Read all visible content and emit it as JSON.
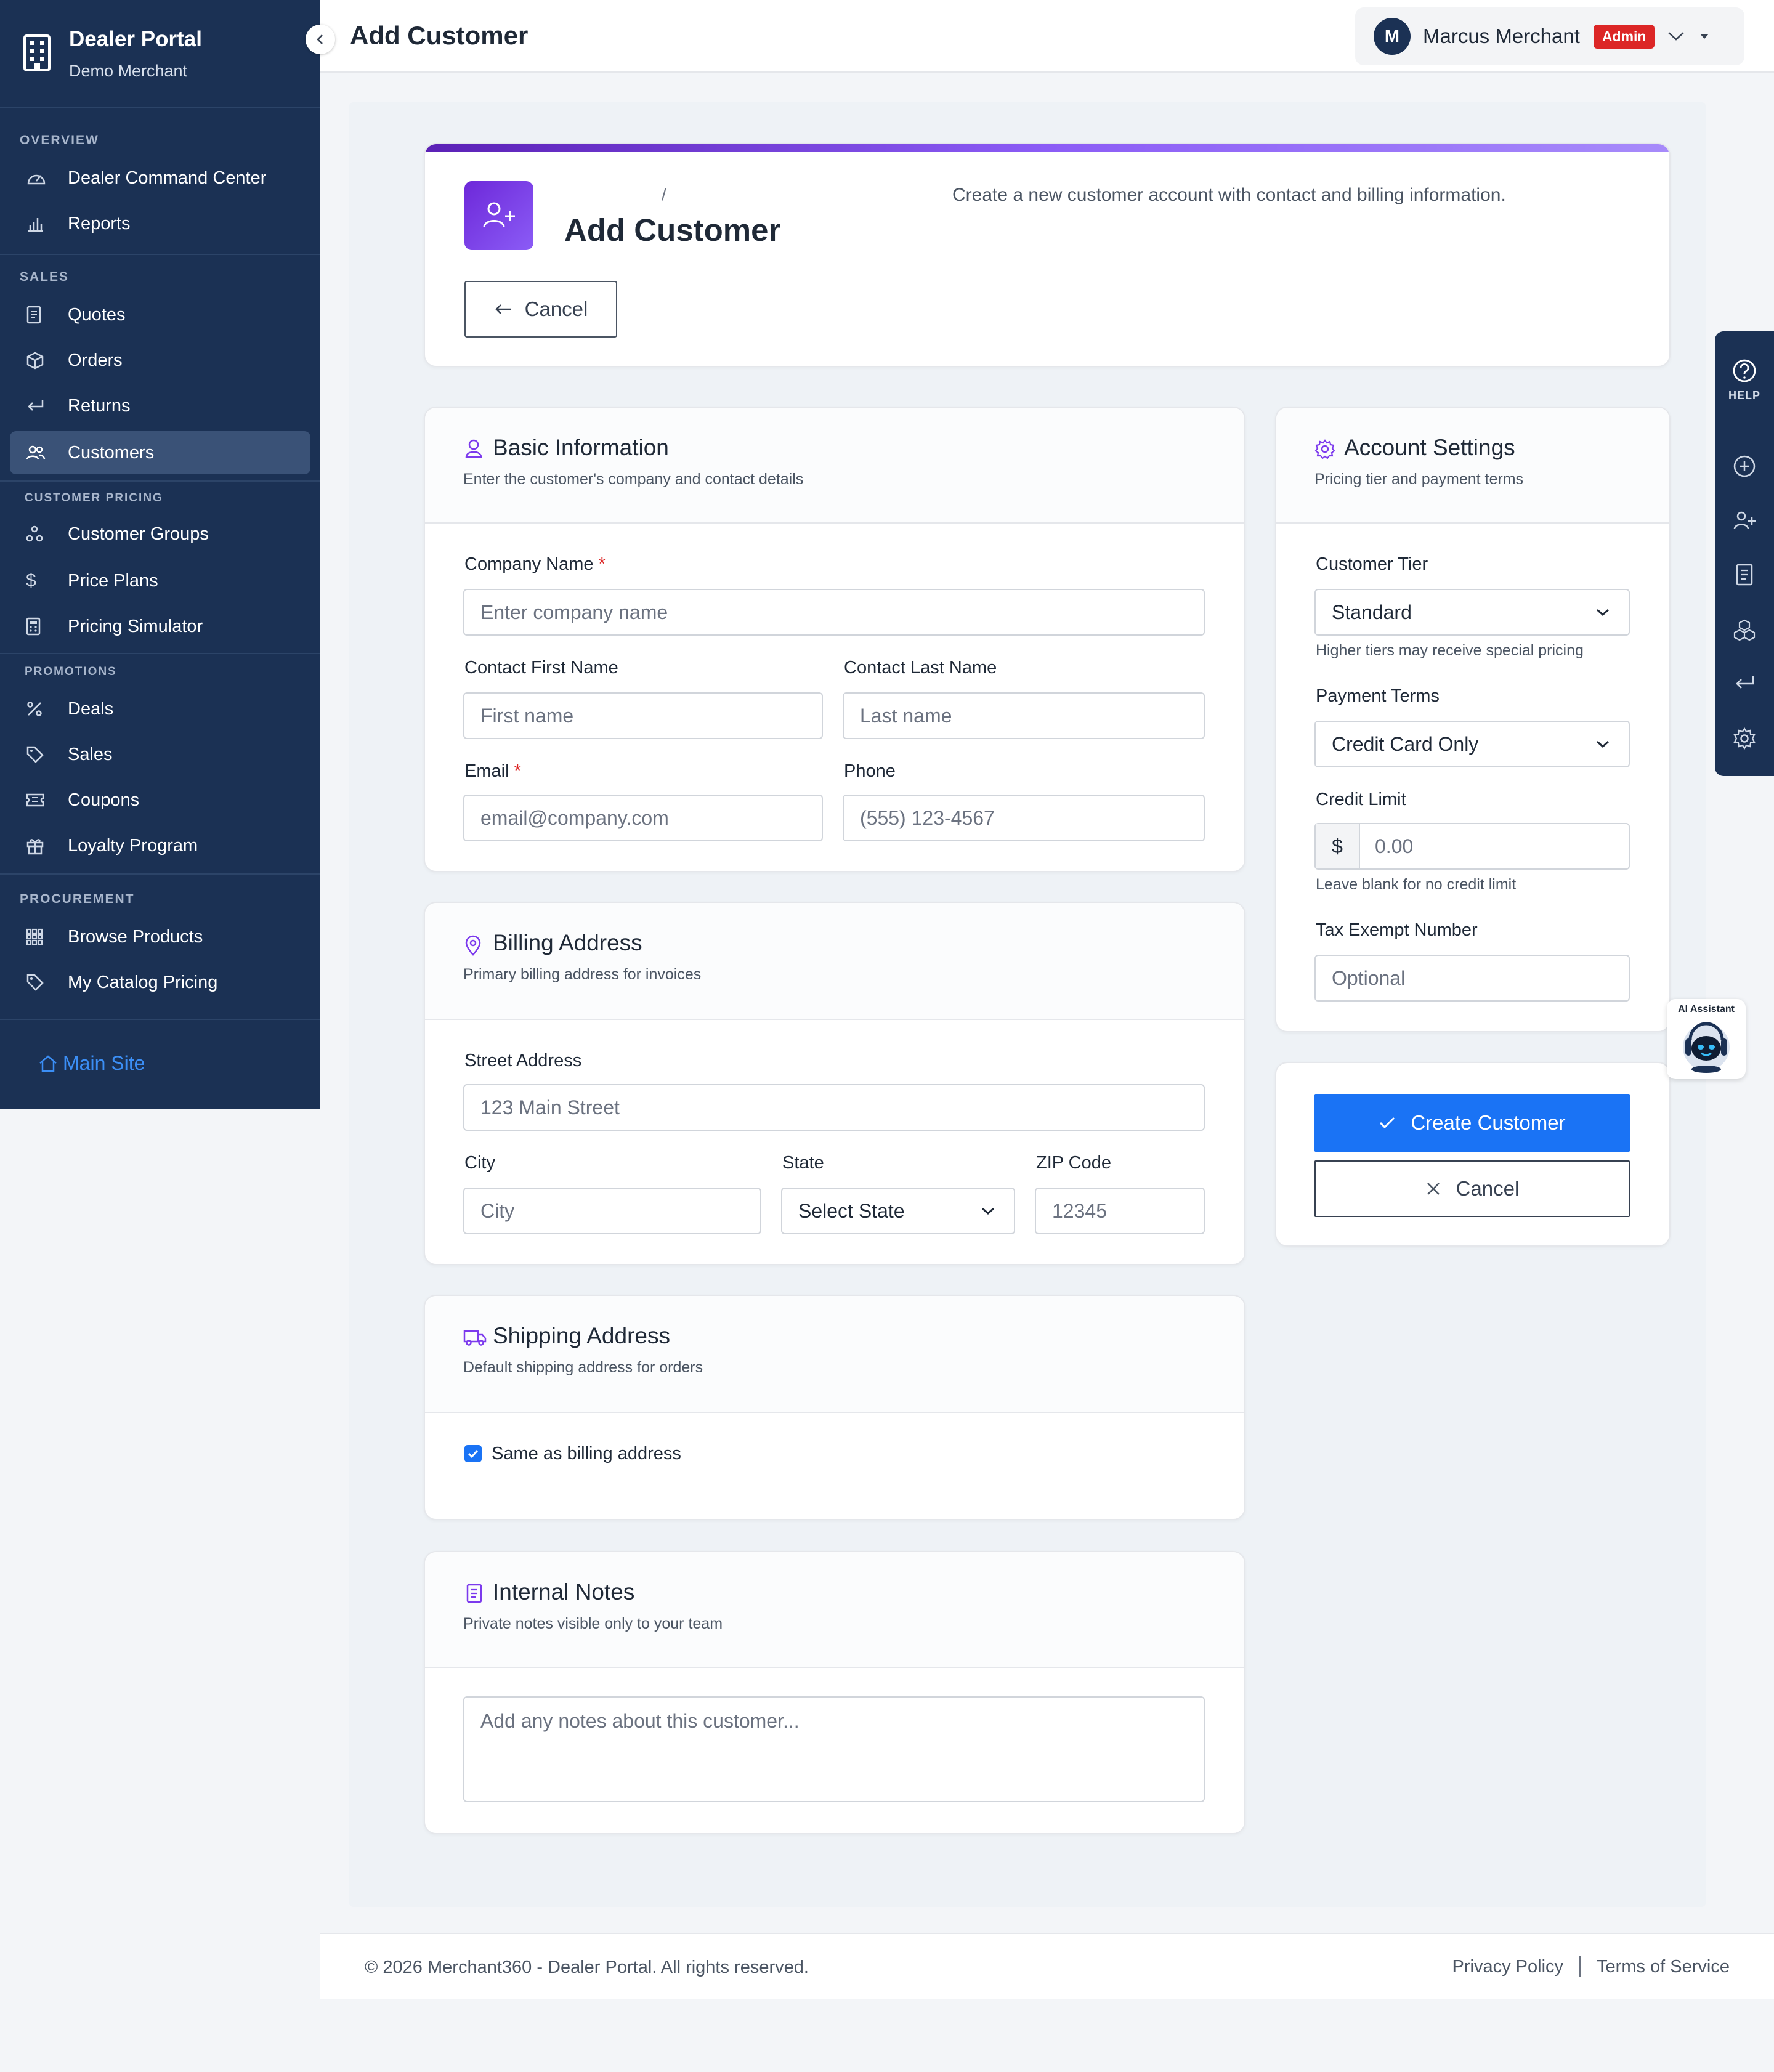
{
  "sidebar": {
    "title": "Dealer Portal",
    "subtitle": "Demo Merchant",
    "sections": {
      "overview": "OVERVIEW",
      "sales": "SALES",
      "customer_pricing": "CUSTOMER PRICING",
      "promotions": "PROMOTIONS",
      "procurement": "PROCUREMENT"
    },
    "items": {
      "dealer_command_center": "Dealer Command Center",
      "reports": "Reports",
      "quotes": "Quotes",
      "orders": "Orders",
      "returns": "Returns",
      "customers": "Customers",
      "customer_groups": "Customer Groups",
      "price_plans": "Price Plans",
      "pricing_simulator": "Pricing Simulator",
      "deals": "Deals",
      "sales": "Sales",
      "coupons": "Coupons",
      "loyalty_program": "Loyalty Program",
      "browse_products": "Browse Products",
      "my_catalog_pricing": "My Catalog Pricing"
    },
    "active_item": "Customers",
    "main_site": "Main Site"
  },
  "topbar": {
    "title": "Add Customer",
    "user": {
      "initial": "M",
      "name": "Marcus Merchant",
      "role_badge": "Admin"
    }
  },
  "hero": {
    "breadcrumb_separator": "/",
    "title": "Add Customer",
    "description": "Create a new customer account with contact and billing information.",
    "cancel_label": "Cancel"
  },
  "basic_info": {
    "title": "Basic Information",
    "subtitle": "Enter the customer's company and contact details",
    "company_label": "Company Name",
    "company_placeholder": "Enter company name",
    "first_name_label": "Contact First Name",
    "first_name_placeholder": "First name",
    "last_name_label": "Contact Last Name",
    "last_name_placeholder": "Last name",
    "email_label": "Email",
    "email_placeholder": "email@company.com",
    "phone_label": "Phone",
    "phone_placeholder": "(555) 123-4567",
    "required_mark": "*"
  },
  "billing": {
    "title": "Billing Address",
    "subtitle": "Primary billing address for invoices",
    "street_label": "Street Address",
    "street_placeholder": "123 Main Street",
    "city_label": "City",
    "city_placeholder": "City",
    "state_label": "State",
    "state_value": "Select State",
    "zip_label": "ZIP Code",
    "zip_placeholder": "12345"
  },
  "shipping": {
    "title": "Shipping Address",
    "subtitle": "Default shipping address for orders",
    "same_as_billing_label": "Same as billing address",
    "same_as_billing_checked": true
  },
  "notes": {
    "title": "Internal Notes",
    "subtitle": "Private notes visible only to your team",
    "placeholder": "Add any notes about this customer..."
  },
  "account": {
    "title": "Account Settings",
    "subtitle": "Pricing tier and payment terms",
    "tier_label": "Customer Tier",
    "tier_value": "Standard",
    "tier_hint": "Higher tiers may receive special pricing",
    "terms_label": "Payment Terms",
    "terms_value": "Credit Card Only",
    "credit_label": "Credit Limit",
    "credit_prefix": "$",
    "credit_placeholder": "0.00",
    "credit_hint": "Leave blank for no credit limit",
    "tax_label": "Tax Exempt Number",
    "tax_placeholder": "Optional"
  },
  "actions": {
    "create_label": "Create Customer",
    "cancel_label": "Cancel"
  },
  "help_rail": {
    "help_label": "HELP"
  },
  "ai_assistant": {
    "label": "AI Assistant"
  },
  "footer": {
    "copyright": "© 2026 Merchant360 - Dealer Portal. All rights reserved.",
    "privacy": "Privacy Policy",
    "terms": "Terms of Service"
  },
  "colors": {
    "sidebar_bg": "#1b3154",
    "primary": "#1a73f5",
    "accent_purple": "#7c3aed",
    "danger": "#dc2626"
  }
}
